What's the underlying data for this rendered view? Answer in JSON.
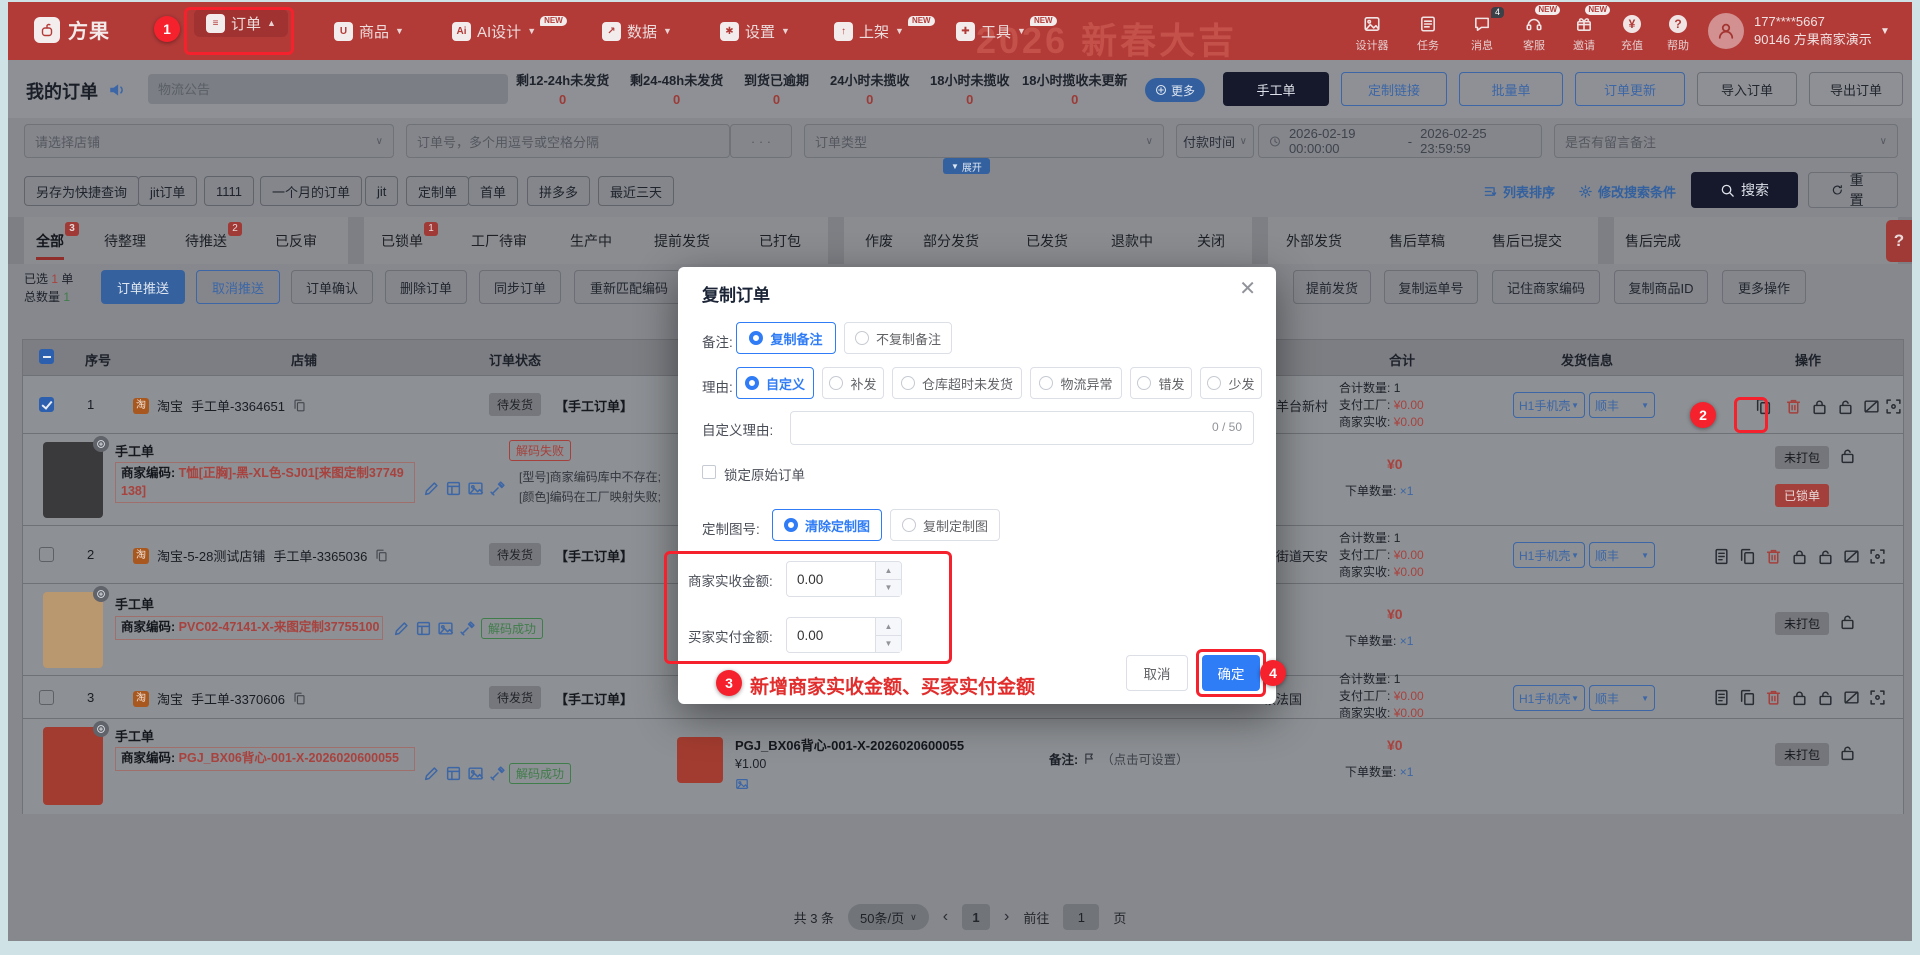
{
  "navbar": {
    "brand": "方果",
    "watermark": "2026 新春大吉",
    "menus": [
      {
        "label": "订单",
        "caret": "▲",
        "glyph": "≡"
      },
      {
        "label": "商品",
        "caret": "▼",
        "glyph": "U"
      },
      {
        "label": "AI设计",
        "caret": "▼",
        "glyph": "Ai",
        "badge": "NEW"
      },
      {
        "label": "数据",
        "caret": "▼",
        "glyph": "↗"
      },
      {
        "label": "设置",
        "caret": "▼",
        "glyph": "✱"
      },
      {
        "label": "上架",
        "caret": "▼",
        "glyph": "↑",
        "badge": "NEW"
      },
      {
        "label": "工具",
        "caret": "▼",
        "glyph": "✚",
        "badge": "NEW"
      }
    ],
    "right_items": [
      {
        "label": "设计器"
      },
      {
        "label": "任务"
      },
      {
        "label": "消息",
        "count": "4"
      },
      {
        "label": "客服",
        "badge": "NEW"
      },
      {
        "label": "邀请",
        "badge": "NEW"
      },
      {
        "label": "充值",
        "glyph": "¥"
      },
      {
        "label": "帮助",
        "glyph": "?"
      }
    ],
    "user": {
      "phone": "177****5667",
      "account": "90146 方果商家演示"
    }
  },
  "toolbar": {
    "title": "我的订单",
    "notice_placeholder": "物流公告",
    "stats": [
      {
        "label": "剩12-24h未发货",
        "value": "0"
      },
      {
        "label": "剩24-48h未发货",
        "value": "0"
      },
      {
        "label": "到货已逾期",
        "value": "0"
      },
      {
        "label": "24小时未揽收",
        "value": "0"
      },
      {
        "label": "18小时未揽收",
        "value": "0"
      },
      {
        "label": "18小时揽收未更新",
        "value": "0"
      }
    ],
    "more_label": "更多",
    "buttons": {
      "manual": "手工单",
      "custom_link": "定制链接",
      "batch": "批量单",
      "order_update": "订单更新",
      "import": "导入订单",
      "export": "导出订单"
    }
  },
  "filters": {
    "shop_placeholder": "请选择店铺",
    "order_no_placeholder": "订单号，多个用逗号或空格分隔",
    "order_no_more": "· · ·",
    "order_type_placeholder": "订单类型",
    "pay_time_label": "付款时间",
    "date_start": "2026-02-19 00:00:00",
    "date_sep": "-",
    "date_end": "2026-02-25 23:59:59",
    "remark_placeholder": "是否有留言备注",
    "expand_label": "展开",
    "quick_filters": [
      "另存为快捷查询",
      "jit订单",
      "1111",
      "一个月的订单",
      "jit",
      "定制单",
      "首单",
      "拼多多",
      "最近三天"
    ],
    "sort_label": "列表排序",
    "modify_label": "修改搜索条件",
    "search_label": "搜索",
    "reset_label": "重置"
  },
  "tabs": {
    "g0": [
      {
        "label": "全部",
        "badge": "3"
      },
      {
        "label": "待整理"
      },
      {
        "label": "待推送",
        "badge": "2"
      },
      {
        "label": "已反审"
      }
    ],
    "g1": [
      {
        "label": "已锁单",
        "badge": "1"
      },
      {
        "label": "工厂待审"
      },
      {
        "label": "生产中"
      },
      {
        "label": "提前发货"
      },
      {
        "label": "已打包"
      }
    ],
    "g2": [
      {
        "label": "作废"
      },
      {
        "label": "部分发货"
      },
      {
        "label": "已发货"
      },
      {
        "label": "退款中"
      },
      {
        "label": "关闭"
      }
    ],
    "g3": [
      {
        "label": "外部发货"
      },
      {
        "label": "售后草稿"
      },
      {
        "label": "售后已提交"
      }
    ],
    "g4": [
      {
        "label": "售后完成"
      }
    ],
    "help": "?"
  },
  "actions": {
    "selected_prefix": "已选",
    "selected_count": "1",
    "selected_suffix": "单",
    "total_label": "总数量",
    "total_count": "1",
    "push": "订单推送",
    "cancel_push": "取消推送",
    "confirm_order": "订单确认",
    "delete": "删除订单",
    "sync": "同步订单",
    "rematch": "重新匹配编码",
    "advance": "提前发货",
    "copy_tracking": "复制运单号",
    "remember_code": "记住商家编码",
    "copy_pid": "复制商品ID",
    "more": "更多操作"
  },
  "table": {
    "headers": {
      "seq": "序号",
      "shop": "店铺",
      "status": "订单状态",
      "total": "合计",
      "ship": "发货信息",
      "ops": "操作"
    },
    "orders": [
      {
        "seq": "1",
        "platform": "淘",
        "shop": "淘宝",
        "order_no": "手工单-3364651",
        "status": "待发货",
        "type": "【手工订单】",
        "address": "区羊台新村",
        "qty_label": "合计数量:",
        "qty": "1",
        "pay_label": "支付工厂:",
        "pay": "¥0.00",
        "recv_label": "商家实收:",
        "recv": "¥0.00",
        "ship1": "H1手机壳",
        "ship2": "顺丰",
        "item": {
          "title": "手工单",
          "code_label": "商家编码: ",
          "code": "T恤[正胸]-黑-XL色-SJ01[来图定制37749138]",
          "decode": "解码失败",
          "err1": "[型号]商家编码库中不存在;",
          "err2": "[颜色]编码在工厂映射失败;",
          "price": "¥0",
          "qty_label": "下单数量:",
          "qty": "×1",
          "pack": "未打包",
          "lock": "已锁单"
        }
      },
      {
        "seq": "2",
        "platform": "淘",
        "shop": "淘宝-5-28测试店铺",
        "order_no": "手工单-3365036",
        "status": "待发货",
        "type": "【手工订单】",
        "address": "岗街道天安",
        "qty_label": "合计数量:",
        "qty": "1",
        "pay_label": "支付工厂:",
        "pay": "¥0.00",
        "recv_label": "商家实收:",
        "recv": "¥0.00",
        "ship1": "H1手机壳",
        "ship2": "顺丰",
        "item": {
          "title": "手工单",
          "code_label": "商家编码: ",
          "code": "PVC02-47141-X-来图定制37755100",
          "decode": "解码成功",
          "price": "¥0",
          "qty_label": "下单数量:",
          "qty": "×1",
          "pack": "未打包"
        }
      },
      {
        "seq": "3",
        "platform": "淘",
        "shop": "淘宝",
        "order_no": "手工单-3370606",
        "status": "待发货",
        "type": "【手工订单】",
        "address": "顿法国",
        "qty_label": "合计数量:",
        "qty": "1",
        "pay_label": "支付工厂:",
        "pay": "¥0.00",
        "recv_label": "商家实收:",
        "recv": "¥0.00",
        "ship1": "H1手机壳",
        "ship2": "顺丰",
        "item": {
          "title": "手工单",
          "code_label": "商家编码: ",
          "code": "PGJ_BX06背心-001-X-2026020600055",
          "decode": "解码成功",
          "price": "¥0",
          "qty_label": "下单数量:",
          "qty": "×1",
          "pack": "未打包",
          "detail_name": "PGJ_BX06背心-001-X-2026020600055",
          "detail_price": "¥1.00",
          "remark_label": "备注:",
          "remark_hint": "（点击可设置）"
        }
      }
    ]
  },
  "modal": {
    "title": "复制订单",
    "remark_label": "备注:",
    "remark_opt1": "复制备注",
    "remark_opt2": "不复制备注",
    "reason_label": "理由:",
    "reason_opts": [
      "自定义",
      "补发",
      "仓库超时未发货",
      "物流异常",
      "错发",
      "少发"
    ],
    "custom_reason_label": "自定义理由:",
    "counter": "0 / 50",
    "lock_label": "锁定原始订单",
    "image_label": "定制图号:",
    "image_opt1": "清除定制图",
    "image_opt2": "复制定制图",
    "merchant_label": "商家实收金额:",
    "merchant_value": "0.00",
    "buyer_label": "买家实付金额:",
    "buyer_value": "0.00",
    "cancel": "取消",
    "confirm": "确定"
  },
  "annotations": {
    "s1": "1",
    "s2": "2",
    "s3": "3",
    "s4": "4",
    "note": "新增商家实收金额、买家实付金额"
  },
  "pagination": {
    "total": "共 3 条",
    "size": "50条/页",
    "prev": "‹",
    "page": "1",
    "next": "›",
    "goto": "前往",
    "goto_value": "1",
    "unit": "页"
  },
  "colors": {
    "brand_red": "#b23b38",
    "primary_blue": "#2e7cf6",
    "annotation_red": "#f5222d"
  }
}
